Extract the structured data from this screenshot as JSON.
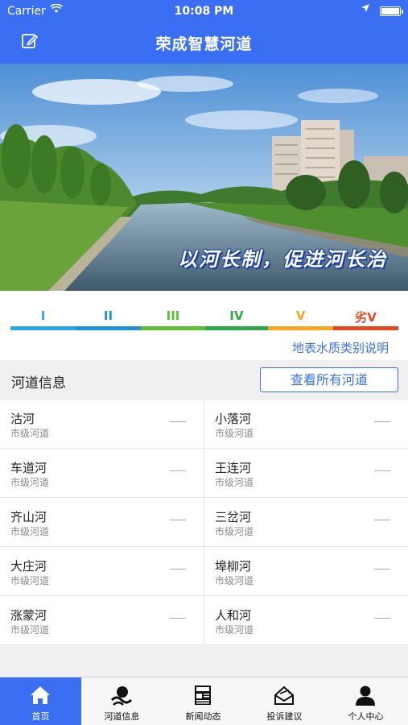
{
  "status_bar": {
    "carrier": "Carrier",
    "time": "10:08 PM"
  },
  "nav": {
    "title": "荣成智慧河道",
    "edit_icon": "edit-icon"
  },
  "banner": {
    "slogan": "以河长制，促进河长治"
  },
  "water_quality": {
    "levels": [
      {
        "label": "I",
        "color": "#29a9e6"
      },
      {
        "label": "II",
        "color": "#1f8fd6"
      },
      {
        "label": "III",
        "color": "#5ec02e"
      },
      {
        "label": "IV",
        "color": "#2aa84a"
      },
      {
        "label": "V",
        "color": "#f5a623"
      },
      {
        "label": "劣V",
        "color": "#e8471d"
      }
    ],
    "link": "地表水质类别说明"
  },
  "rivers_section": {
    "title": "河道信息",
    "view_all": "查看所有河道"
  },
  "rivers": [
    {
      "name": "沽河",
      "type": "市级河道"
    },
    {
      "name": "小落河",
      "type": "市级河道"
    },
    {
      "name": "车道河",
      "type": "市级河道"
    },
    {
      "name": "王连河",
      "type": "市级河道"
    },
    {
      "name": "齐山河",
      "type": "市级河道"
    },
    {
      "name": "三岔河",
      "type": "市级河道"
    },
    {
      "name": "大庄河",
      "type": "市级河道"
    },
    {
      "name": "埠柳河",
      "type": "市级河道"
    },
    {
      "name": "涨蒙河",
      "type": "市级河道"
    },
    {
      "name": "人和河",
      "type": "市级河道"
    }
  ],
  "tabs": [
    {
      "label": "首页",
      "icon": "home-icon"
    },
    {
      "label": "河道信息",
      "icon": "river-info-icon"
    },
    {
      "label": "新闻动态",
      "icon": "news-icon"
    },
    {
      "label": "投诉建议",
      "icon": "complaint-icon"
    },
    {
      "label": "个人中心",
      "icon": "user-icon"
    }
  ]
}
